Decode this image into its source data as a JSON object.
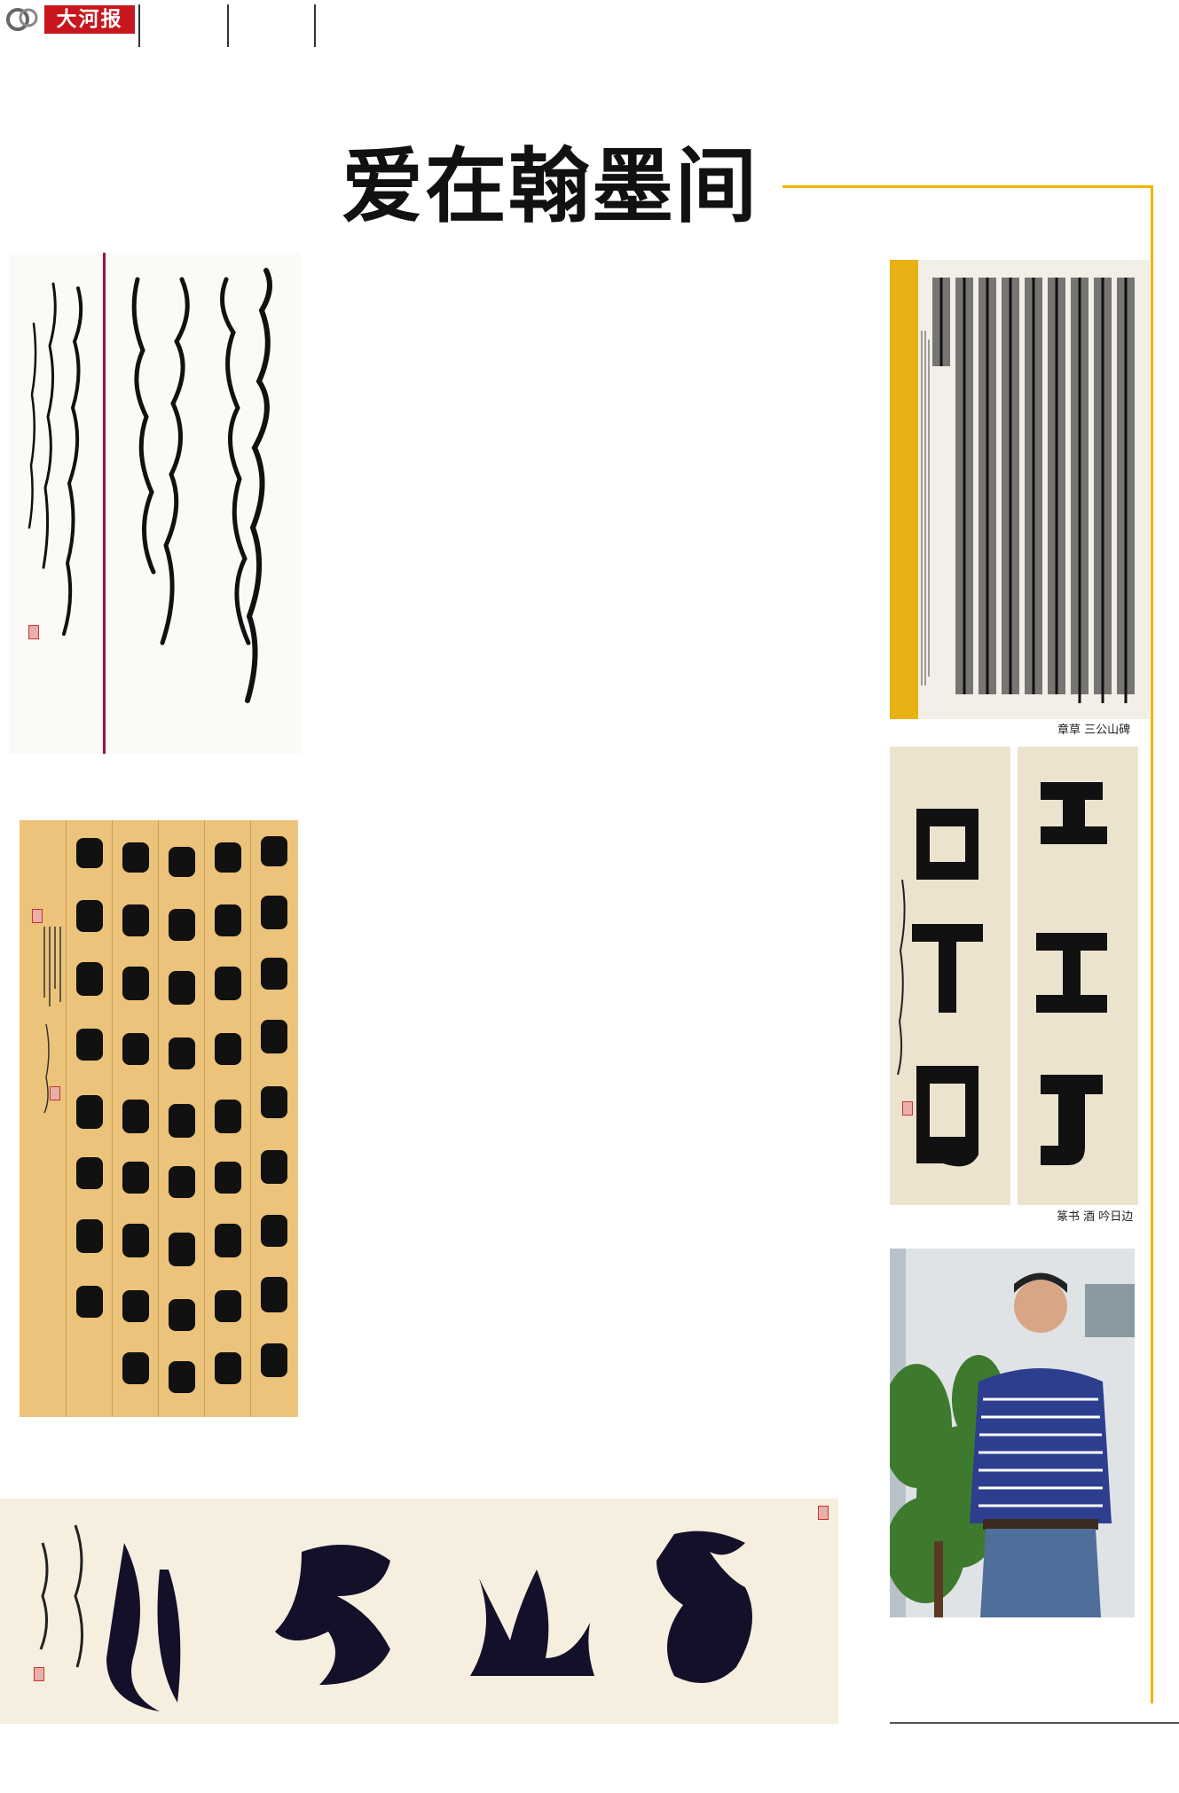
{
  "header": {
    "logo_text": "大河报"
  },
  "title": "爱在翰墨间",
  "captions": {
    "art3": "章草 三公山碑",
    "art4": "篆书 酒 吟日边"
  },
  "colors": {
    "accent_rule": "#f0b400",
    "logo_red": "#c8161d"
  }
}
